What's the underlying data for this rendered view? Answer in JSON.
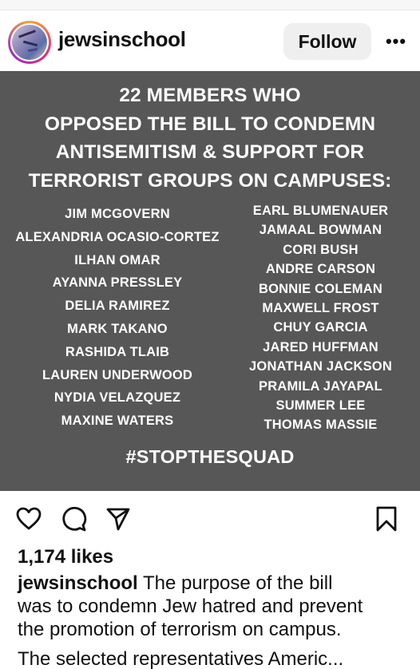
{
  "header": {
    "username": "jewsinschool",
    "follow_label": "Follow",
    "more_label": "•••"
  },
  "post": {
    "headline": [
      "22 MEMBERS WHO",
      "OPPOSED THE BILL TO CONDEMN",
      "ANTISEMITISM & SUPPORT FOR",
      "TERRORIST GROUPS ON CAMPUSES:"
    ],
    "members_left": [
      "JIM MCGOVERN",
      "ALEXANDRIA OCASIO-CORTEZ",
      "ILHAN OMAR",
      "AYANNA PRESSLEY",
      "DELIA RAMIREZ",
      "MARK TAKANO",
      "RASHIDA TLAIB",
      "LAUREN UNDERWOOD",
      "NYDIA VELAZQUEZ",
      "MAXINE WATERS"
    ],
    "members_right": [
      "EARL BLUMENAUER",
      "JAMAAL BOWMAN",
      "CORI BUSH",
      "ANDRE CARSON",
      "BONNIE COLEMAN",
      "MAXWELL FROST",
      "CHUY GARCIA",
      "JARED HUFFMAN",
      "JONATHAN JACKSON",
      "PRAMILA JAYAPAL",
      "SUMMER LEE",
      "THOMAS MASSIE"
    ],
    "hashtag": "#STOPTHESQUAD",
    "background_color": "#575757"
  },
  "actions": {
    "icons": [
      "heart-icon",
      "comment-icon",
      "share-icon",
      "bookmark-icon"
    ]
  },
  "likes": "1,174 likes",
  "caption": {
    "username": "jewsinschool",
    "line1_rest": " The purpose of the bill",
    "line2": "was to condemn Jew hatred and prevent",
    "line3": "the promotion of terrorism on campus.",
    "line4_partial": "The selected representatives Americ..."
  }
}
